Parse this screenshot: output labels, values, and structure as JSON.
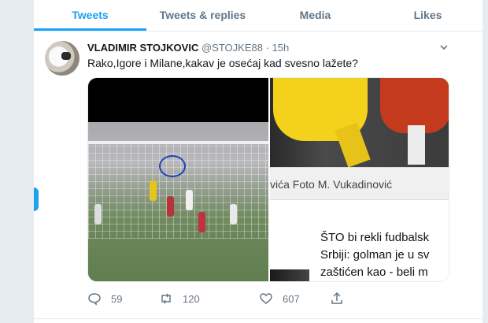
{
  "tabs": [
    {
      "label": "Tweets",
      "active": true
    },
    {
      "label": "Tweets & replies",
      "active": false
    },
    {
      "label": "Media",
      "active": false
    },
    {
      "label": "Likes",
      "active": false
    }
  ],
  "tweet": {
    "display_name": "VLADIMIR STOJKOVIC",
    "handle": "@STOJKE88",
    "separator": "·",
    "time": "15h",
    "text": "Rako,Igore i Milane,kakav je osećaj kad svesno lažete?",
    "media": {
      "caption": "vića Foto M. Vukadinović",
      "headline_line1": "ŠTO bi rekli fudbalsk",
      "headline_line2": "Srbiji: golman je u sv",
      "headline_line3": "zaštićen kao - beli m"
    },
    "actions": {
      "replies": "59",
      "retweets": "120",
      "likes": "607"
    }
  },
  "colors": {
    "accent": "#1da1f2",
    "secondary_text": "#657786",
    "primary_text": "#14171a"
  },
  "icons": {
    "reply": "reply-icon",
    "retweet": "retweet-icon",
    "like": "heart-icon",
    "share": "share-icon",
    "menu": "chevron-down-icon"
  }
}
